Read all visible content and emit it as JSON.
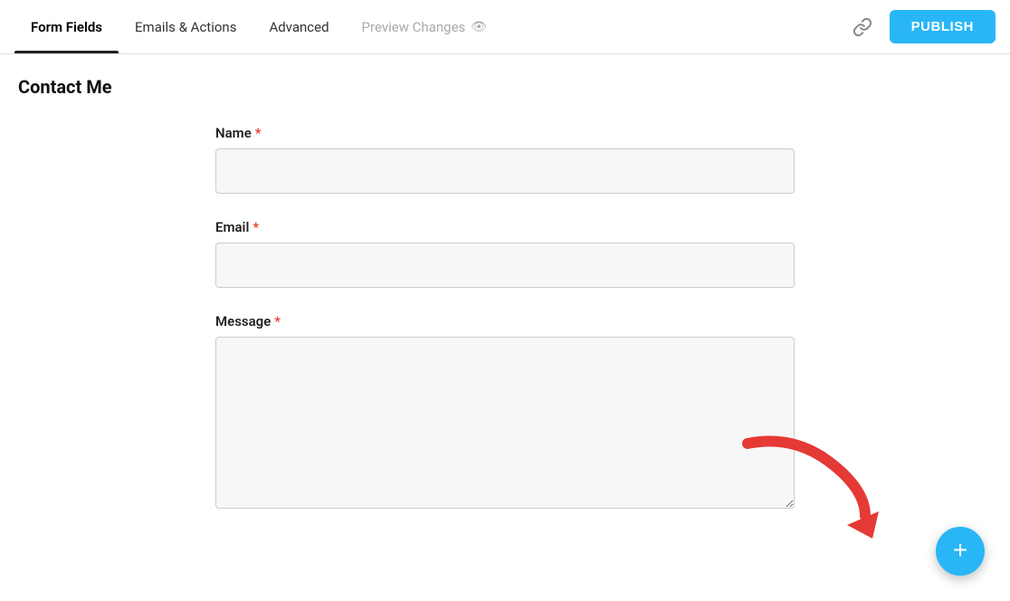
{
  "header": {
    "tabs": [
      {
        "id": "form-fields",
        "label": "Form Fields",
        "active": true
      },
      {
        "id": "emails-actions",
        "label": "Emails & Actions",
        "active": false
      },
      {
        "id": "advanced",
        "label": "Advanced",
        "active": false
      },
      {
        "id": "preview-changes",
        "label": "Preview Changes",
        "active": false,
        "preview": true
      }
    ],
    "publish_label": "PUBLISH"
  },
  "page": {
    "title": "Contact Me"
  },
  "form": {
    "fields": [
      {
        "id": "name",
        "label": "Name",
        "required": true,
        "type": "input"
      },
      {
        "id": "email",
        "label": "Email",
        "required": true,
        "type": "input"
      },
      {
        "id": "message",
        "label": "Message",
        "required": true,
        "type": "textarea"
      }
    ]
  },
  "fab": {
    "label": "+"
  },
  "icons": {
    "link": "link-icon",
    "eye": "👁",
    "plus": "+"
  }
}
